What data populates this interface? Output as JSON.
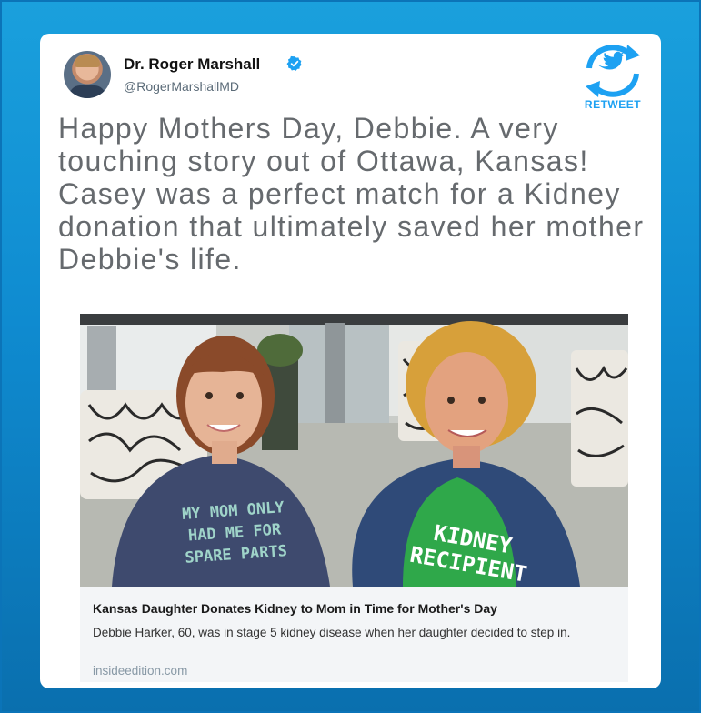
{
  "tweet": {
    "author_name": "Dr. Roger Marshall",
    "author_handle": "@RogerMarshallMD",
    "verified": true,
    "text": "Happy Mothers Day, Debbie. A very touching story out of Ottawa, Kansas! Casey was a perfect match for a Kidney donation that ultimately saved her mother Debbie's life."
  },
  "badge": {
    "label": "RETWEET",
    "icon": "retweet-bird-icon",
    "color": "#1da1f2"
  },
  "media": {
    "shirt_left": [
      "MY MOM ONLY",
      "HAD ME FOR",
      "SPARE PARTS"
    ],
    "shirt_right": [
      "KIDNEY",
      "RECIPIENT"
    ]
  },
  "link_card": {
    "title": "Kansas Daughter Donates Kidney to Mom in Time for Mother's Day",
    "description": "Debbie Harker, 60, was in stage 5 kidney disease when her daughter decided to step in.",
    "domain": "insideedition.com"
  },
  "colors": {
    "frame": "#1aa0dd",
    "verified": "#1da1f2"
  }
}
